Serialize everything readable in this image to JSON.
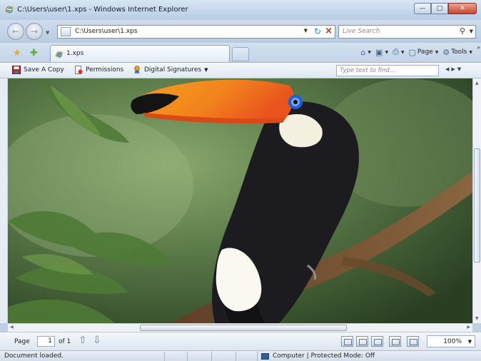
{
  "window": {
    "title": "C:\\Users\\user\\1.xps - Windows Internet Explorer"
  },
  "address": {
    "url": "C:\\Users\\user\\1.xps",
    "search_placeholder": "Live Search"
  },
  "tabs": [
    {
      "label": "1.xps"
    }
  ],
  "command_bar": {
    "page_label": "Page",
    "tools_label": "Tools"
  },
  "xps_toolbar": {
    "save_copy": "Save A Copy",
    "permissions": "Permissions",
    "digital_signatures": "Digital Signatures",
    "find_placeholder": "Type text to find..."
  },
  "page_nav": {
    "label": "Page",
    "current": "1",
    "of_text": "of 1",
    "zoom": "100%"
  },
  "status": {
    "text": "Document loaded.",
    "zone": "Computer | Protected Mode: Off"
  },
  "document_image": {
    "subject": "toco toucan on a branch"
  },
  "colors": {
    "accent": "#3b82c4",
    "close_button": "#c8462c",
    "beak_orange": "#f2821d"
  }
}
